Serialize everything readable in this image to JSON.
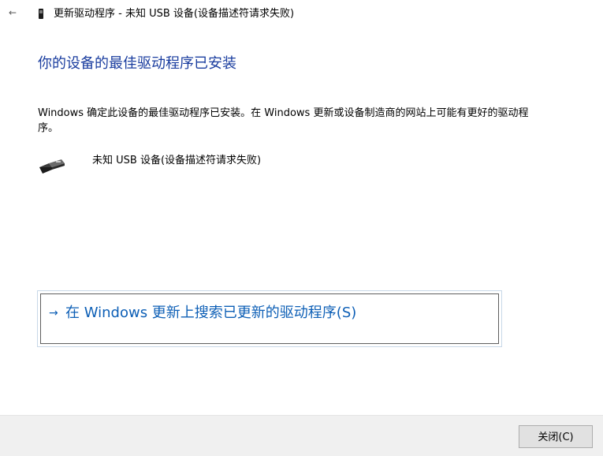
{
  "window": {
    "back_glyph": "←",
    "title": "更新驱动程序 - 未知 USB 设备(设备描述符请求失败)",
    "title_icon": "device-icon"
  },
  "main": {
    "heading": "你的设备的最佳驱动程序已安装",
    "description": "Windows 确定此设备的最佳驱动程序已安装。在 Windows 更新或设备制造商的网站上可能有更好的驱动程序。",
    "device": {
      "icon": "usb-connector-icon",
      "name": "未知 USB 设备(设备描述符请求失败)"
    },
    "search_option": {
      "arrow": "→",
      "label": "在 Windows 更新上搜索已更新的驱动程序(S)"
    }
  },
  "footer": {
    "close_label": "关闭(C)"
  },
  "colors": {
    "heading": "#1a3d9f",
    "link": "#0d5fb6",
    "footer_bg": "#f0f0f0",
    "button_bg": "#e1e1e1"
  }
}
